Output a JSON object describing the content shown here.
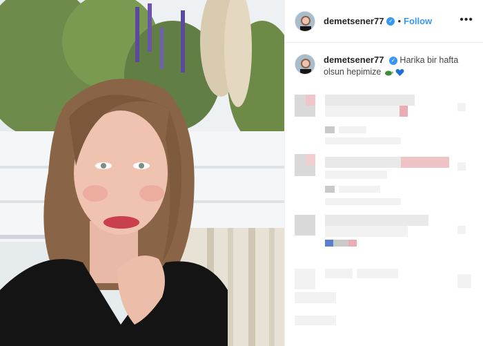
{
  "post": {
    "username": "demetsener77",
    "verified_badge": "✓",
    "separator": "•",
    "follow_label": "Follow",
    "more_icon": "•••",
    "caption": {
      "username": "demetsener77",
      "text": "Harika bir hafta olsun hepimize",
      "emojis": [
        "turtle-emoji",
        "blue-heart-emoji"
      ]
    }
  },
  "colors": {
    "accent": "#3897f0",
    "text": "#262626",
    "heart": "#1f6fd6"
  }
}
